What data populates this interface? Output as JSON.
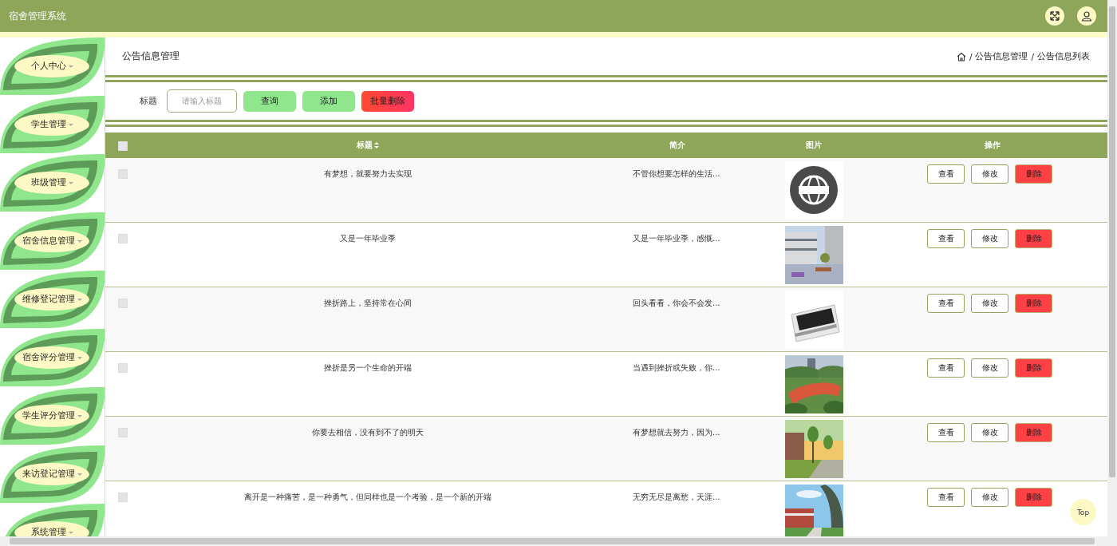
{
  "header": {
    "title": "宿舍管理系统"
  },
  "sidebar": {
    "items": [
      {
        "label": "个人中心"
      },
      {
        "label": "学生管理"
      },
      {
        "label": "班级管理"
      },
      {
        "label": "宿舍信息管理"
      },
      {
        "label": "维修登记管理"
      },
      {
        "label": "宿舍评分管理"
      },
      {
        "label": "学生评分管理"
      },
      {
        "label": "来访登记管理"
      },
      {
        "label": "系统管理"
      }
    ]
  },
  "page": {
    "title": "公告信息管理",
    "breadcrumb_separator": "/",
    "breadcrumb": [
      "公告信息管理",
      "公告信息列表"
    ]
  },
  "search": {
    "label": "标题",
    "placeholder": "请输入标题",
    "buttons": [
      {
        "label": "查询",
        "kind": "query"
      },
      {
        "label": "添加",
        "kind": "add"
      },
      {
        "label": "批量删除",
        "kind": "danger"
      }
    ]
  },
  "table": {
    "select_all_checked": false,
    "columns": [
      {
        "label": "标题",
        "sortable": true
      },
      {
        "label": "简介",
        "sortable": false
      },
      {
        "label": "图片",
        "sortable": false
      },
      {
        "label": "操作",
        "sortable": false
      }
    ],
    "rows": [
      {
        "checked": false,
        "title": "有梦想，就要努力去实现",
        "intro": "不管你想要怎样的生活...",
        "image": {
          "kind": "picture"
        },
        "actions": [
          {
            "label": "查看",
            "kind": "view"
          },
          {
            "label": "修改",
            "kind": "edit"
          },
          {
            "label": "删除",
            "kind": "delete"
          }
        ]
      },
      {
        "checked": false,
        "title": "又是一年毕业季",
        "intro": "又是一年毕业季，感慨...",
        "image": {
          "kind": "picture"
        },
        "actions": [
          {
            "label": "查看",
            "kind": "view"
          },
          {
            "label": "修改",
            "kind": "edit"
          },
          {
            "label": "删除",
            "kind": "delete"
          }
        ]
      },
      {
        "checked": false,
        "title": "挫折路上，坚持常在心间",
        "intro": "回头看看，你会不会发...",
        "image": {
          "kind": "picture"
        },
        "actions": [
          {
            "label": "查看",
            "kind": "view"
          },
          {
            "label": "修改",
            "kind": "edit"
          },
          {
            "label": "删除",
            "kind": "delete"
          }
        ]
      },
      {
        "checked": false,
        "title": "挫折是另一个生命的开端",
        "intro": "当遇到挫折或失败，你...",
        "image": {
          "kind": "picture"
        },
        "actions": [
          {
            "label": "查看",
            "kind": "view"
          },
          {
            "label": "修改",
            "kind": "edit"
          },
          {
            "label": "删除",
            "kind": "delete"
          }
        ]
      },
      {
        "checked": false,
        "title": "你要去相信，没有到不了的明天",
        "intro": "有梦想就去努力，因为...",
        "image": {
          "kind": "picture"
        },
        "actions": [
          {
            "label": "查看",
            "kind": "view"
          },
          {
            "label": "修改",
            "kind": "edit"
          },
          {
            "label": "删除",
            "kind": "delete"
          }
        ]
      },
      {
        "checked": false,
        "title": "离开是一种痛苦，是一种勇气，但同样也是一个考验，是一个新的开端",
        "intro": "无穷无尽是离愁，天涯...",
        "image": {
          "kind": "picture"
        },
        "actions": [
          {
            "label": "查看",
            "kind": "view"
          },
          {
            "label": "修改",
            "kind": "edit"
          },
          {
            "label": "删除",
            "kind": "delete"
          }
        ]
      }
    ]
  },
  "back_to_top": "Top"
}
